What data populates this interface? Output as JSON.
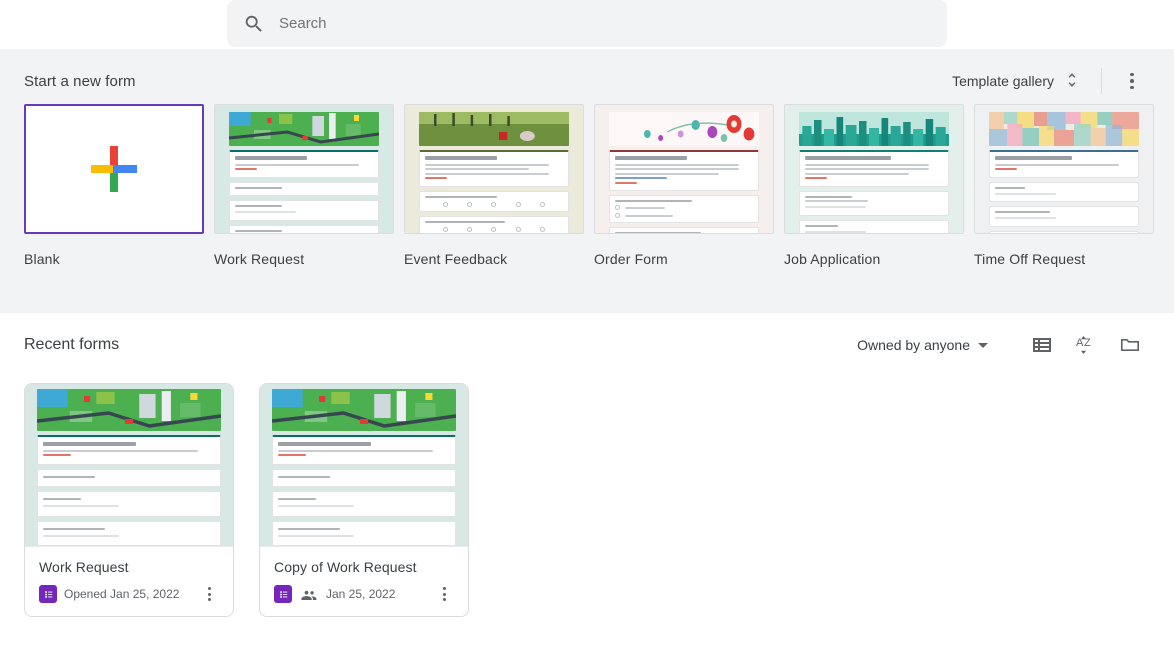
{
  "search": {
    "placeholder": "Search",
    "value": "",
    "icon": "search-icon"
  },
  "templates_section": {
    "title": "Start a new form",
    "gallery_label": "Template gallery",
    "gallery_icon": "unfold-more-icon",
    "more_icon": "more-vert-icon",
    "selected_index": 0,
    "accent_selected": "#673ab7",
    "items": [
      {
        "label": "Blank",
        "kind": "blank"
      },
      {
        "label": "Work Request",
        "kind": "preview",
        "preview_title": "Work Request",
        "bg": "#d7e8e5",
        "banner": "city-map-illustration"
      },
      {
        "label": "Event Feedback",
        "kind": "preview",
        "preview_title": "Event Feedback",
        "bg": "#eceadb",
        "banner": "picnic-photo"
      },
      {
        "label": "Order Form",
        "kind": "preview",
        "preview_title": "Order Request",
        "bg": "#f7eeee",
        "banner": "floral-illustration"
      },
      {
        "label": "Job Application",
        "kind": "preview",
        "preview_title": "Job application form",
        "bg": "#e2efeb",
        "banner": "city-skyline-illustration"
      },
      {
        "label": "Time Off Request",
        "kind": "preview",
        "preview_title": "Time off request",
        "bg": "#eef0f2",
        "banner": "watercolor-mosaic"
      }
    ]
  },
  "recent_section": {
    "title": "Recent forms",
    "owner_filter": "Owned by anyone",
    "list_view_icon": "list-view-icon",
    "sort_icon": "sort-az-icon",
    "folder_icon": "folder-icon",
    "forms": [
      {
        "name": "Work Request",
        "date": "Opened Jan 25, 2022",
        "shared": false,
        "thumb_title": "Work Request",
        "thumb_bg": "#d7e8e5",
        "badge_color": "#7627bb"
      },
      {
        "name": "Copy of Work Request",
        "date": "Jan 25, 2022",
        "shared": true,
        "thumb_title": "Work Request",
        "thumb_bg": "#d7e8e5",
        "badge_color": "#7627bb"
      }
    ]
  }
}
